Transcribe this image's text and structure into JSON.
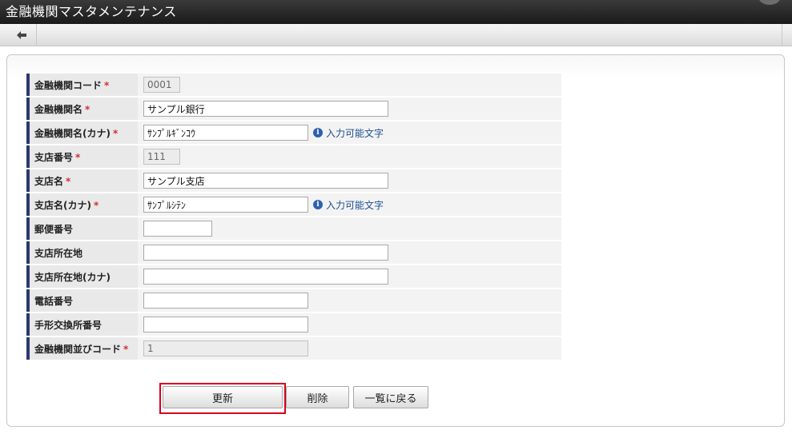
{
  "window": {
    "title": "金融機関マスタメンテナンス"
  },
  "toolbar": {
    "back_icon": "left-arrow-icon"
  },
  "form": {
    "required_mark": "*",
    "fields": [
      {
        "label": "金融機関コード",
        "value": "0001",
        "readonly": true
      },
      {
        "label": "金融機関名",
        "value": "サンプル銀行"
      },
      {
        "label": "金融機関名(カナ)",
        "value": "ｻﾝﾌﾟﾙｷﾞﾝｺｳ",
        "hint": "入力可能文字"
      },
      {
        "label": "支店番号",
        "value": "111",
        "readonly": true
      },
      {
        "label": "支店名",
        "value": "サンプル支店"
      },
      {
        "label": "支店名(カナ)",
        "value": "ｻﾝﾌﾟﾙｼﾃﾝ",
        "hint": "入力可能文字"
      },
      {
        "label": "郵便番号",
        "value": ""
      },
      {
        "label": "支店所在地",
        "value": ""
      },
      {
        "label": "支店所在地(カナ)",
        "value": ""
      },
      {
        "label": "電話番号",
        "value": ""
      },
      {
        "label": "手形交換所番号",
        "value": ""
      },
      {
        "label": "金融機関並びコード",
        "value": "1",
        "readonly": true
      }
    ]
  },
  "buttons": {
    "update": "更新",
    "delete": "削除",
    "back_to_list": "一覧に戻る"
  },
  "colors": {
    "highlight": "#d6001c",
    "label_accent": "#2b3a6e",
    "required": "#d23030",
    "link": "#1d4f8f"
  }
}
